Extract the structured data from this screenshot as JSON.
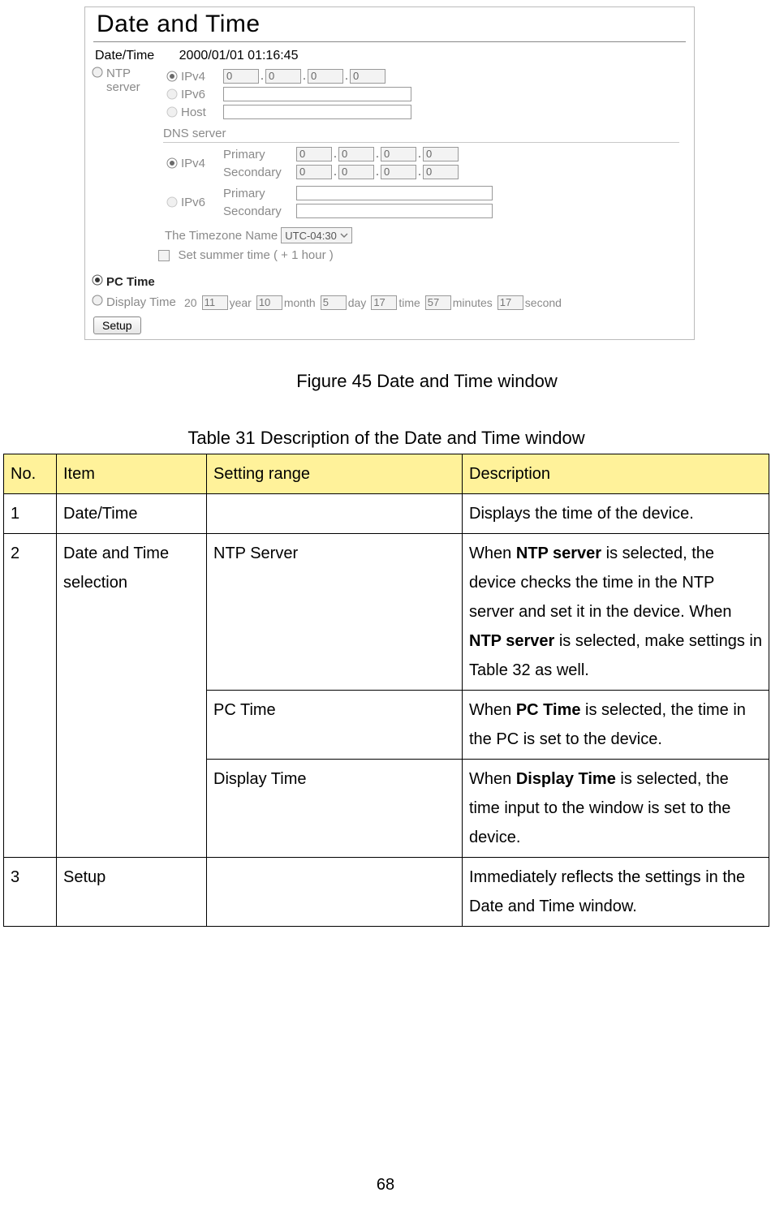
{
  "panel": {
    "title": "Date and Time",
    "date_label": "Date/Time",
    "date_value": "2000/01/01 01:16:45",
    "ntp": {
      "label": "NTP server",
      "ipv4": {
        "label": "IPv4",
        "o1": "0",
        "o2": "0",
        "o3": "0",
        "o4": "0"
      },
      "ipv6": {
        "label": "IPv6"
      },
      "host": {
        "label": "Host"
      }
    },
    "dns": {
      "title": "DNS server",
      "ipv4": {
        "label": "IPv4",
        "primary_label": "Primary",
        "secondary_label": "Secondary",
        "p1": "0",
        "p2": "0",
        "p3": "0",
        "p4": "0",
        "s1": "0",
        "s2": "0",
        "s3": "0",
        "s4": "0"
      },
      "ipv6": {
        "label": "IPv6",
        "primary_label": "Primary",
        "secondary_label": "Secondary"
      }
    },
    "tz": {
      "label": "The Timezone Name",
      "value": "UTC-04:30"
    },
    "summer": {
      "label": "Set summer time ( + 1 hour )"
    },
    "pc": {
      "label": "PC Time"
    },
    "display": {
      "label": "Display Time",
      "year_prefix": "20",
      "year": "11",
      "year_lbl": "year",
      "month": "10",
      "month_lbl": "month",
      "day": "5",
      "day_lbl": "day",
      "hour": "17",
      "hour_lbl": "time",
      "min": "57",
      "min_lbl": "minutes",
      "sec": "17",
      "sec_lbl": "second"
    },
    "setup_btn": "Setup"
  },
  "figure_caption": "Figure 45 Date and Time window",
  "table_caption": "Table 31 Description of the Date and Time window",
  "table": {
    "headers": {
      "no": "No.",
      "item": "Item",
      "range": "Setting range",
      "desc": "Description"
    },
    "rows": {
      "r1": {
        "no": "1",
        "item": "Date/Time",
        "range": "",
        "desc": "Displays the time of the device."
      },
      "r2a": {
        "no": "2",
        "item": "Date and Time selection",
        "range": "NTP Server",
        "desc_pre": "When ",
        "desc_b1": "NTP server",
        "desc_mid": " is selected, the device checks the time in the NTP server and set it in the device. When ",
        "desc_b2": "NTP server",
        "desc_post": " is selected, make settings in Table 32 as well."
      },
      "r2b": {
        "range": "PC Time",
        "desc_pre": "When ",
        "desc_b": "PC Time",
        "desc_post": " is selected, the time in the PC is set to the device."
      },
      "r2c": {
        "range": "Display Time",
        "desc_pre": "When ",
        "desc_b": "Display Time",
        "desc_post": " is selected, the time input to the window is set to the device."
      },
      "r3": {
        "no": "3",
        "item": "Setup",
        "range": "",
        "desc": "Immediately reflects the settings in the Date and Time window."
      }
    }
  },
  "page_number": "68"
}
